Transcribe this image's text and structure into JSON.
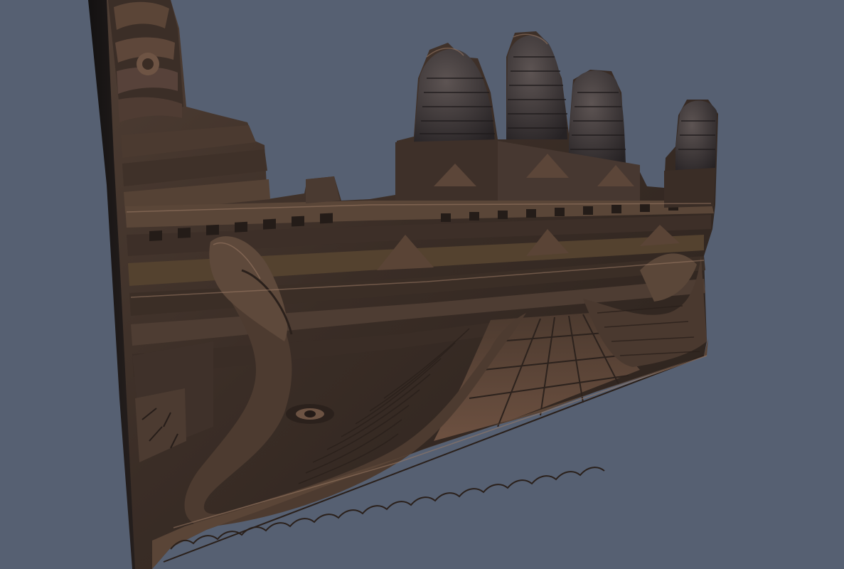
{
  "scene": {
    "background_color": "#566072",
    "subject": "carved-wooden-relief-panel",
    "palette": {
      "wood_dark": "#231c19",
      "wood_mid": "#4a3a31",
      "wood_light": "#7a5e4c",
      "highlight": "#a98a75",
      "shadow": "#15110f"
    }
  }
}
